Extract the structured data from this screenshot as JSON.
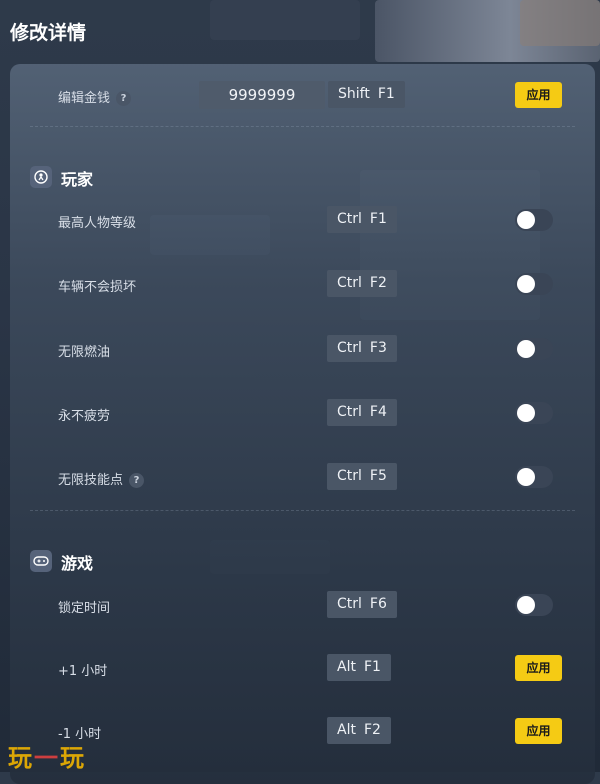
{
  "header": {
    "title": "修改详情"
  },
  "edit_money": {
    "label": "编辑金钱",
    "help": "?",
    "value": "9999999",
    "hotkey": [
      "Shift",
      "F1"
    ],
    "apply_label": "应用"
  },
  "sections": [
    {
      "title": "玩家",
      "icon": "player-icon",
      "rows": [
        {
          "label": "最高人物等级",
          "hotkey": [
            "Ctrl",
            "F1"
          ],
          "control": "toggle",
          "on": false
        },
        {
          "label": "车辆不会损坏",
          "hotkey": [
            "Ctrl",
            "F2"
          ],
          "control": "toggle",
          "on": false
        },
        {
          "label": "无限燃油",
          "hotkey": [
            "Ctrl",
            "F3"
          ],
          "control": "toggle",
          "on": false
        },
        {
          "label": "永不疲劳",
          "hotkey": [
            "Ctrl",
            "F4"
          ],
          "control": "toggle",
          "on": false
        },
        {
          "label": "无限技能点",
          "help": "?",
          "hotkey": [
            "Ctrl",
            "F5"
          ],
          "control": "toggle",
          "on": false
        }
      ]
    },
    {
      "title": "游戏",
      "icon": "gamepad-icon",
      "rows": [
        {
          "label": "锁定时间",
          "hotkey": [
            "Ctrl",
            "F6"
          ],
          "control": "toggle",
          "on": false
        },
        {
          "label": "+1 小时",
          "hotkey": [
            "Alt",
            "F1"
          ],
          "control": "button",
          "apply_label": "应用"
        },
        {
          "label": "-1 小时",
          "hotkey": [
            "Alt",
            "F2"
          ],
          "control": "button",
          "apply_label": "应用"
        }
      ]
    }
  ],
  "watermark": {
    "left": "玩",
    "dash": "一",
    "right": "玩"
  },
  "colors": {
    "accent": "#f5cb14",
    "panel": "#3a4758",
    "hotkey_bg": "#4a5666",
    "toggle_off": "#3a4556"
  }
}
